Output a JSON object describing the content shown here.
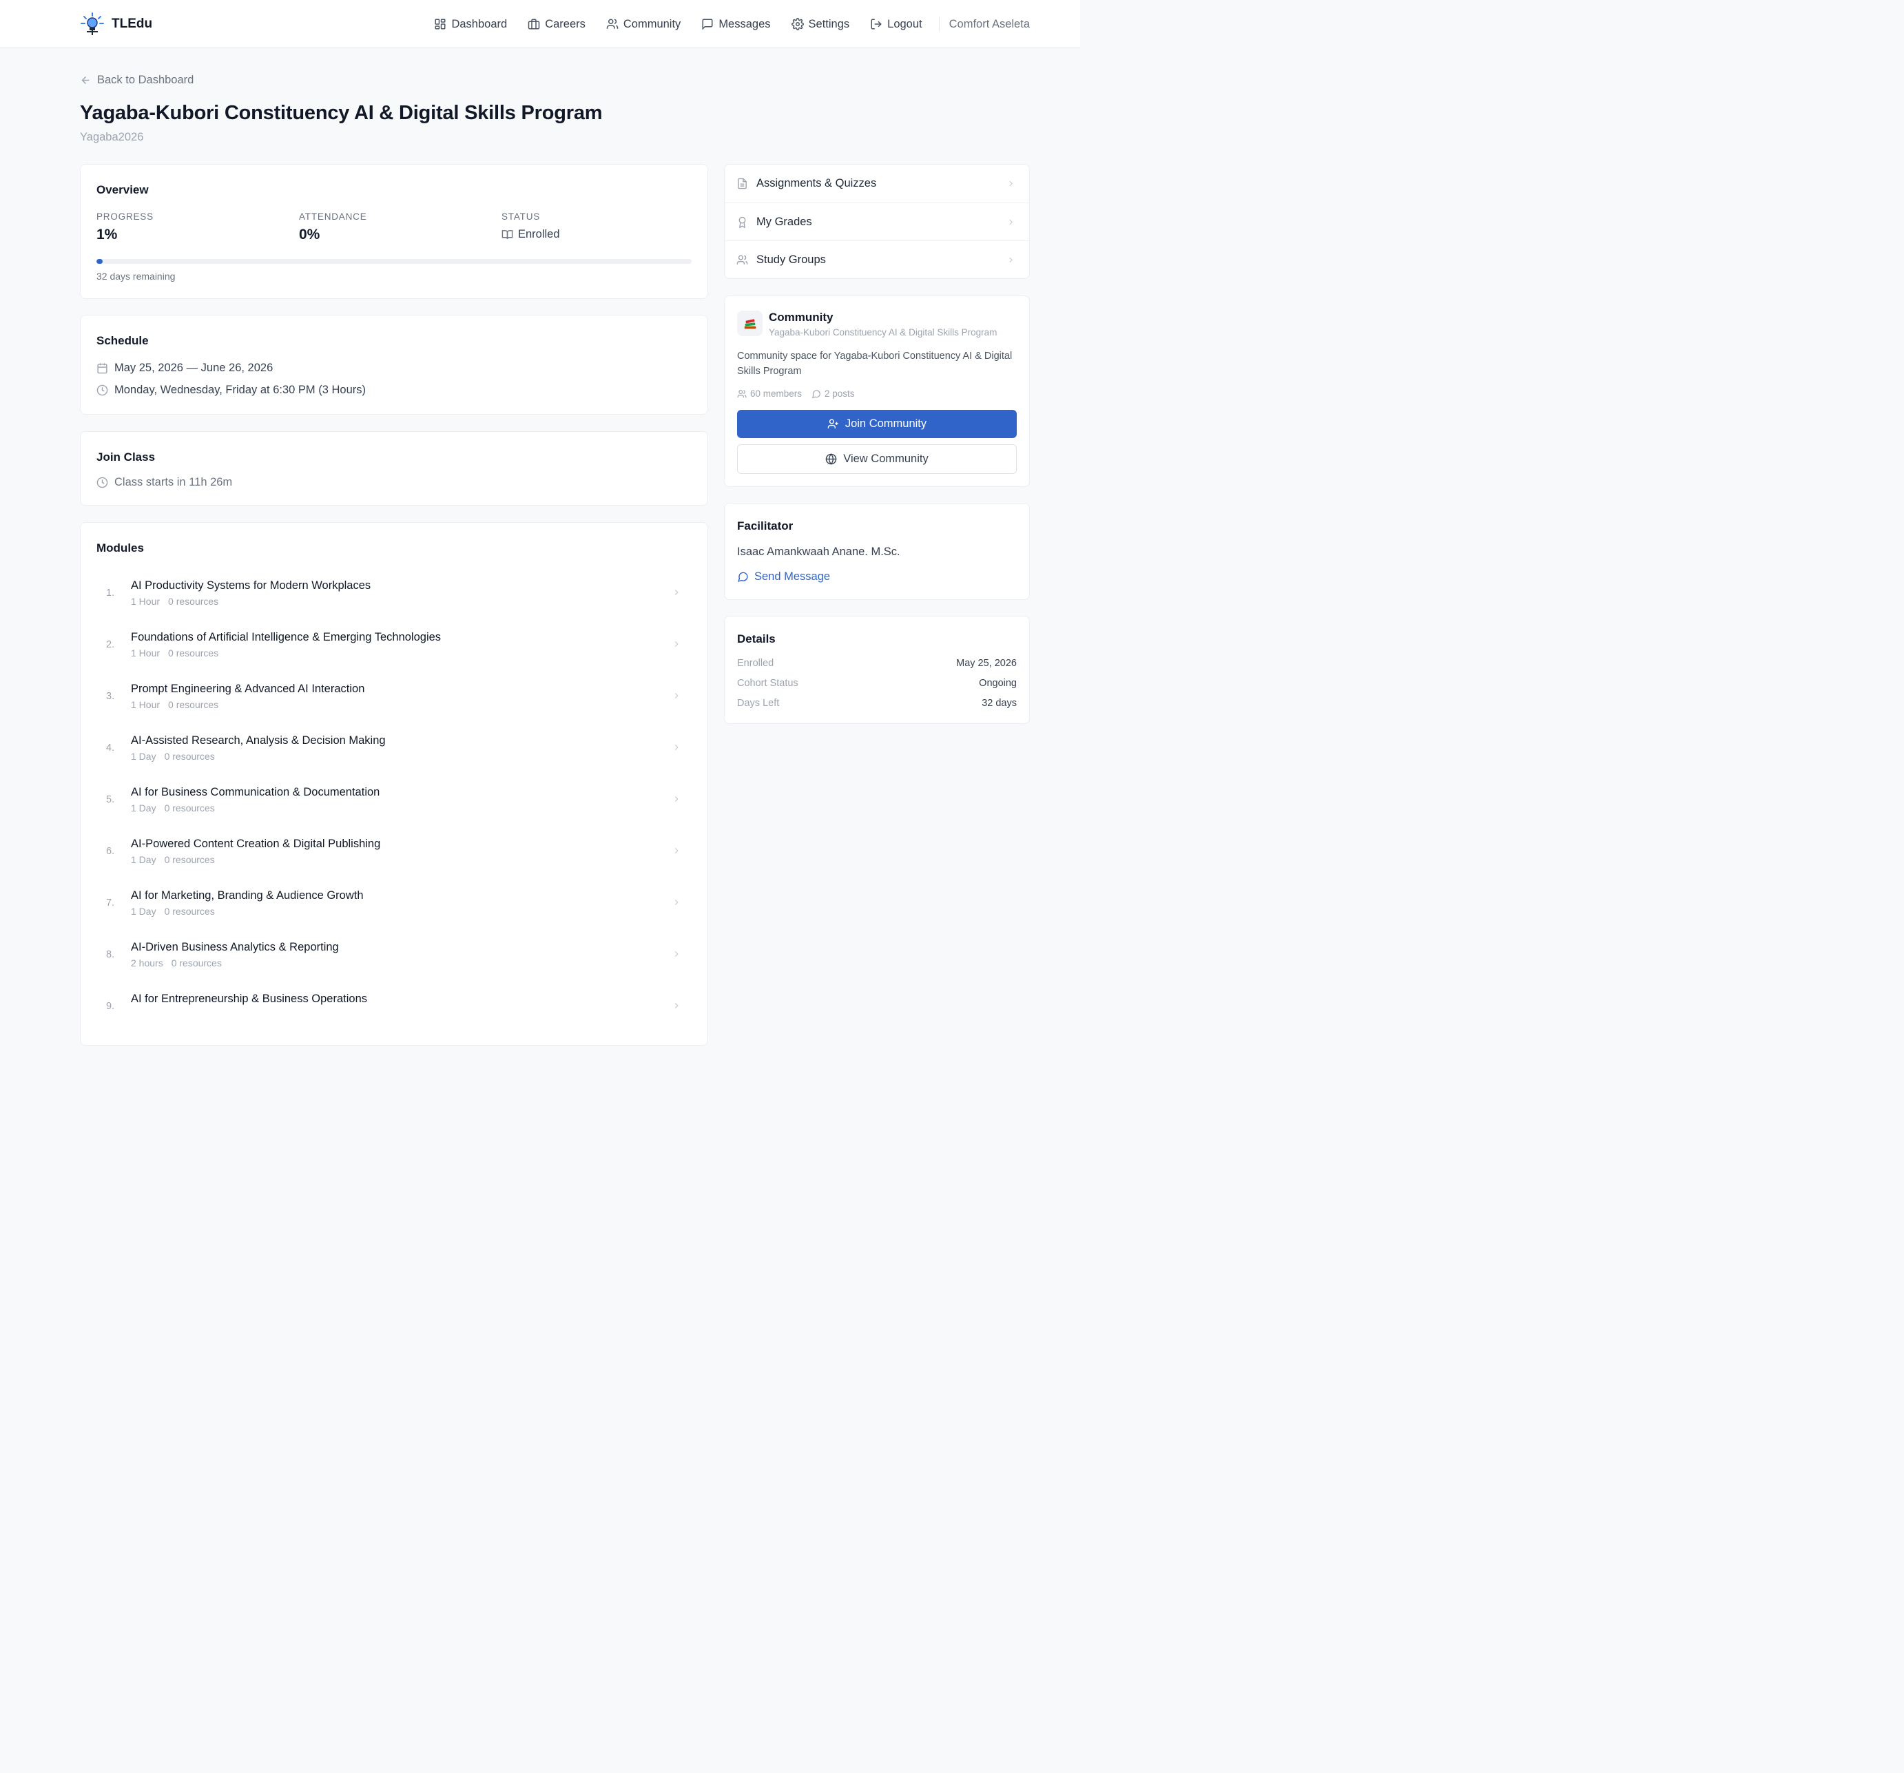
{
  "brand": {
    "name": "TLEdu",
    "logo_icon": "bulb-logo-icon"
  },
  "nav": {
    "items": [
      {
        "label": "Dashboard",
        "icon": "grid-icon"
      },
      {
        "label": "Careers",
        "icon": "briefcase-icon"
      },
      {
        "label": "Community",
        "icon": "users-icon"
      },
      {
        "label": "Messages",
        "icon": "message-square-icon"
      },
      {
        "label": "Settings",
        "icon": "gear-icon"
      },
      {
        "label": "Logout",
        "icon": "logout-icon"
      }
    ],
    "user_name": "Comfort Aseleta"
  },
  "page": {
    "back_label": "Back to Dashboard",
    "title": "Yagaba-Kubori Constituency AI & Digital Skills Program",
    "subtitle": "Yagaba2026"
  },
  "overview": {
    "title": "Overview",
    "progress_label": "PROGRESS",
    "progress_value": "1%",
    "progress_fraction": 0.01,
    "attendance_label": "ATTENDANCE",
    "attendance_value": "0%",
    "status_label": "STATUS",
    "status_value": "Enrolled",
    "days_remaining": "32 days remaining"
  },
  "schedule": {
    "title": "Schedule",
    "dates": "May 25, 2026 — June 26, 2026",
    "times": "Monday, Wednesday, Friday at 6:30 PM (3 Hours)"
  },
  "join_class": {
    "title": "Join Class",
    "countdown": "Class starts in 11h 26m"
  },
  "modules": {
    "title": "Modules",
    "items": [
      {
        "num": "1.",
        "title": "AI Productivity Systems for Modern Workplaces",
        "duration": "1 Hour",
        "resources": "0 resources"
      },
      {
        "num": "2.",
        "title": "Foundations of Artificial Intelligence & Emerging Technologies",
        "duration": "1 Hour",
        "resources": "0 resources"
      },
      {
        "num": "3.",
        "title": "Prompt Engineering & Advanced AI Interaction",
        "duration": "1 Hour",
        "resources": "0 resources"
      },
      {
        "num": "4.",
        "title": "AI-Assisted Research, Analysis & Decision Making",
        "duration": "1 Day",
        "resources": "0 resources"
      },
      {
        "num": "5.",
        "title": "AI for Business Communication & Documentation",
        "duration": "1 Day",
        "resources": "0 resources"
      },
      {
        "num": "6.",
        "title": "AI-Powered Content Creation & Digital Publishing",
        "duration": "1 Day",
        "resources": "0 resources"
      },
      {
        "num": "7.",
        "title": "AI for Marketing, Branding & Audience Growth",
        "duration": "1 Day",
        "resources": "0 resources"
      },
      {
        "num": "8.",
        "title": "AI-Driven Business Analytics & Reporting",
        "duration": "2 hours",
        "resources": "0 resources"
      },
      {
        "num": "9.",
        "title": "AI for Entrepreneurship & Business Operations",
        "duration": "",
        "resources": ""
      }
    ]
  },
  "quick_links": [
    {
      "label": "Assignments & Quizzes",
      "icon": "document-icon"
    },
    {
      "label": "My Grades",
      "icon": "award-icon"
    },
    {
      "label": "Study Groups",
      "icon": "users-icon"
    }
  ],
  "community": {
    "title": "Community",
    "subtitle": "Yagaba-Kubori Constituency AI & Digital Skills Program",
    "description": "Community space for Yagaba-Kubori Constituency AI & Digital Skills Program",
    "members": "60 members",
    "posts": "2 posts",
    "join_label": "Join Community",
    "view_label": "View Community",
    "avatar_icon": "books-icon"
  },
  "facilitator": {
    "title": "Facilitator",
    "name": "Isaac Amankwaah Anane. M.Sc.",
    "message_label": "Send Message"
  },
  "details": {
    "title": "Details",
    "rows": [
      {
        "key": "Enrolled",
        "value": "May 25, 2026"
      },
      {
        "key": "Cohort Status",
        "value": "Ongoing"
      },
      {
        "key": "Days Left",
        "value": "32 days"
      }
    ]
  },
  "colors": {
    "accent": "#3064c9",
    "page_bg": "#f8f9fb",
    "text": "#111827",
    "muted": "#9ca3af"
  }
}
